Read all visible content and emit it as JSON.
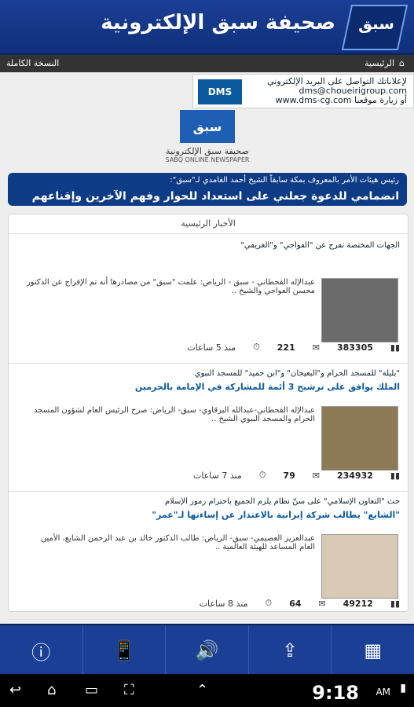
{
  "header": {
    "title": "صحيفة سبق الإلكترونية",
    "logo_text": "سبق"
  },
  "navbar": {
    "home": "الرئيسية",
    "full_version": "النسخة الكاملة"
  },
  "ad": {
    "line1": "لإعلاناتك التواصل على البريد الإلكتروني",
    "line2": "dms@choueirigroup.com",
    "line3": "www.dms-cg.com أو زيارة موقعنا",
    "brand": "DMS"
  },
  "center_logo": {
    "mark": "سبق",
    "subtitle": "صحيفة سبق الإلكترونية",
    "subtitle_en": "SABQ ONLINE NEWSPAPER"
  },
  "notice": {
    "line1": "رئيس هيئات الأمر بالمعروف بمكة سابقاً الشيخ أحمد الغامدي لـ\"سبق\":",
    "line2": "انضمامي للدعوة جعلني على استعداد للحوار وفهم الآخرين وإقناعهم"
  },
  "panel": {
    "heading": "الأخبار الرئيسية",
    "items": [
      {
        "title": "الجهات المختصة تفرج عن \"الفواجي\" و\"الغريفي\"",
        "title2": "",
        "excerpt": "عبدالإله القحطاني - سبق - الرياض: علمت \"سبق\" من مصادرها أنه تم الإفراج عن الدكتور محسن العواجي والشيخ ..",
        "views": "383305",
        "comments": "221",
        "time": "منذ 5 ساعات"
      },
      {
        "title": "\"بليلة\" للمسجد الحرام و\"البعيجان\" و\"ابن حميد\" للمسجد النبوي",
        "title2": "الملك يوافق على ترشيح 3 أئمة للمشاركة في الإمامة بالحرمين",
        "excerpt": "عبدالإله القحطاني-عبدالله البرقاوي- سبق- الرياض: صرح الرئيس العام لشؤون المسجد الحرام والمسجد النبوي الشيخ ..",
        "views": "234932",
        "comments": "79",
        "time": "منذ 7 ساعات"
      },
      {
        "title": "حث \"التعاون الإسلامي\" على سنّ نظام يلزم الجميع باحترام رموز الإسلام",
        "title2": "\"الشايع\" يطالب شركة إيرانية بالاعتذار عن إساءتها لـ\"عمر\"",
        "excerpt": "عبدالعزيز العصيمي- سبق- الرياض: طالب الدكتور خالد بن عبد الرحمن الشايع، الأمين العام المساعد للهيئة العالمية ..",
        "views": "49212",
        "comments": "64",
        "time": "منذ 8 ساعات"
      }
    ]
  },
  "bottom_bar": {
    "buttons": [
      "ⓘ",
      "📱",
      "🔊",
      "⇪",
      "▦"
    ]
  },
  "system_bar": {
    "time": "9:18",
    "ampm": "AM"
  }
}
